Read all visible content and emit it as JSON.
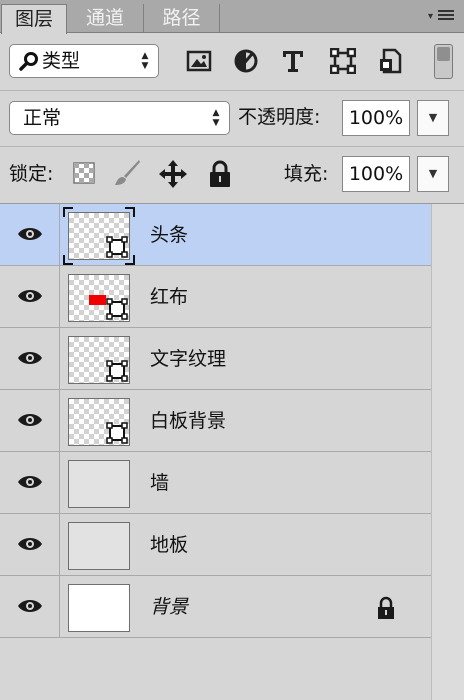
{
  "tabs": [
    {
      "label": "图层"
    },
    {
      "label": "通道"
    },
    {
      "label": "路径"
    }
  ],
  "filter": {
    "kind_label": "类型"
  },
  "blend": {
    "mode": "正常"
  },
  "opacity": {
    "label": "不透明度:",
    "value": "100%"
  },
  "lock": {
    "label": "锁定:"
  },
  "fill": {
    "label": "填充:",
    "value": "100%"
  },
  "layers": [
    {
      "name": "头条",
      "selected": true
    },
    {
      "name": "红布"
    },
    {
      "name": "文字纹理"
    },
    {
      "name": "白板背景"
    },
    {
      "name": "墙"
    },
    {
      "name": "地板"
    },
    {
      "name": "背景",
      "locked": true
    }
  ]
}
